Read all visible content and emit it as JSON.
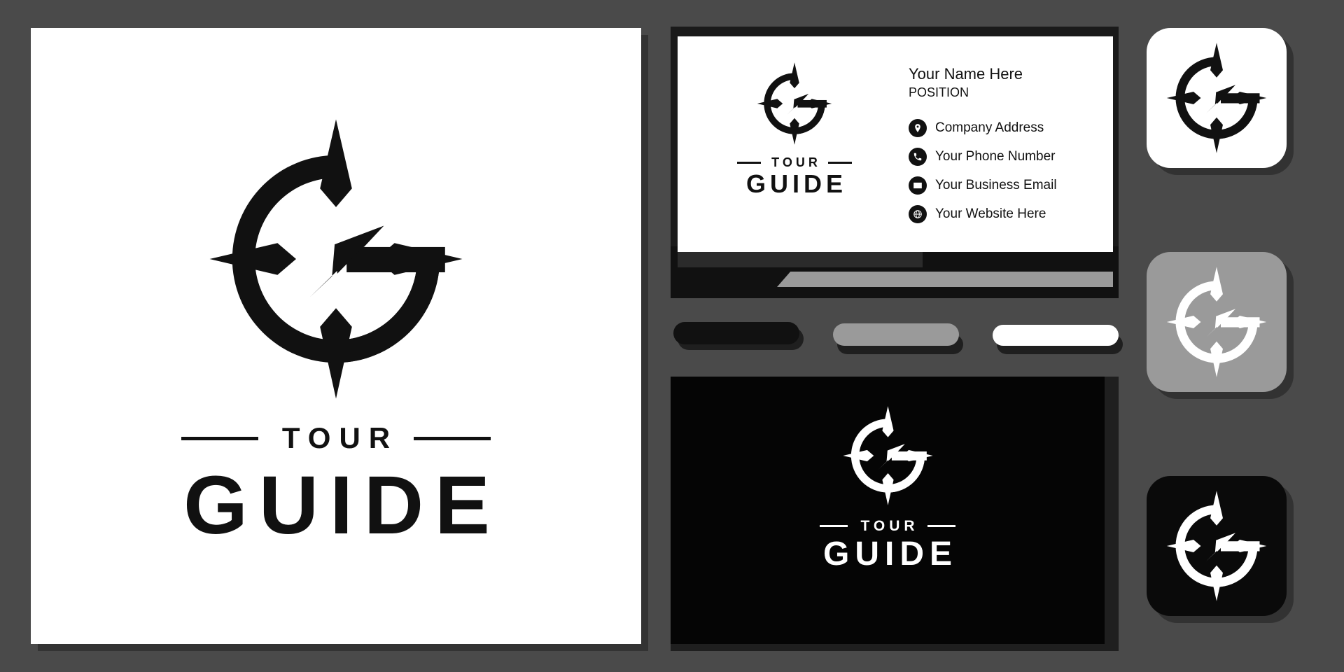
{
  "page": {
    "background_color": "#4a4a4a",
    "title": "Tour Guide Logo Presentation"
  },
  "brand": {
    "name_top": "TOUR",
    "name_bottom": "GUIDE",
    "mark_icon": "compass-arrow-icon",
    "colors": {
      "black": "#111111",
      "white": "#ffffff",
      "gray": "#9a9a9a",
      "panel_gray": "#4a4a4a"
    }
  },
  "main_panel": {
    "background": "#ffffff",
    "tour": "TOUR",
    "guide": "GUIDE"
  },
  "business_card": {
    "front_background": "#ffffff",
    "logo": {
      "tour": "TOUR",
      "guide": "GUIDE"
    },
    "name": "Your Name Here",
    "position": "POSITION",
    "contacts": [
      {
        "icon": "location-pin-icon",
        "text": "Company Address"
      },
      {
        "icon": "phone-icon",
        "text": "Your Phone Number"
      },
      {
        "icon": "envelope-icon",
        "text": "Your Business Email"
      },
      {
        "icon": "globe-icon",
        "text": "Your Website Here"
      }
    ]
  },
  "pills": [
    {
      "name": "pill-dark",
      "color": "#111111"
    },
    {
      "name": "pill-gray",
      "color": "#9a9a9a"
    },
    {
      "name": "pill-white",
      "color": "#ffffff"
    }
  ],
  "dark_panel": {
    "background": "#050505",
    "tour": "TOUR",
    "guide": "GUIDE"
  },
  "icon_tiles": [
    {
      "name": "tile-white",
      "background": "#ffffff",
      "mark_color": "#111111"
    },
    {
      "name": "tile-gray",
      "background": "#9a9a9a",
      "mark_color": "#ffffff"
    },
    {
      "name": "tile-black",
      "background": "#0a0a0a",
      "mark_color": "#ffffff"
    }
  ]
}
